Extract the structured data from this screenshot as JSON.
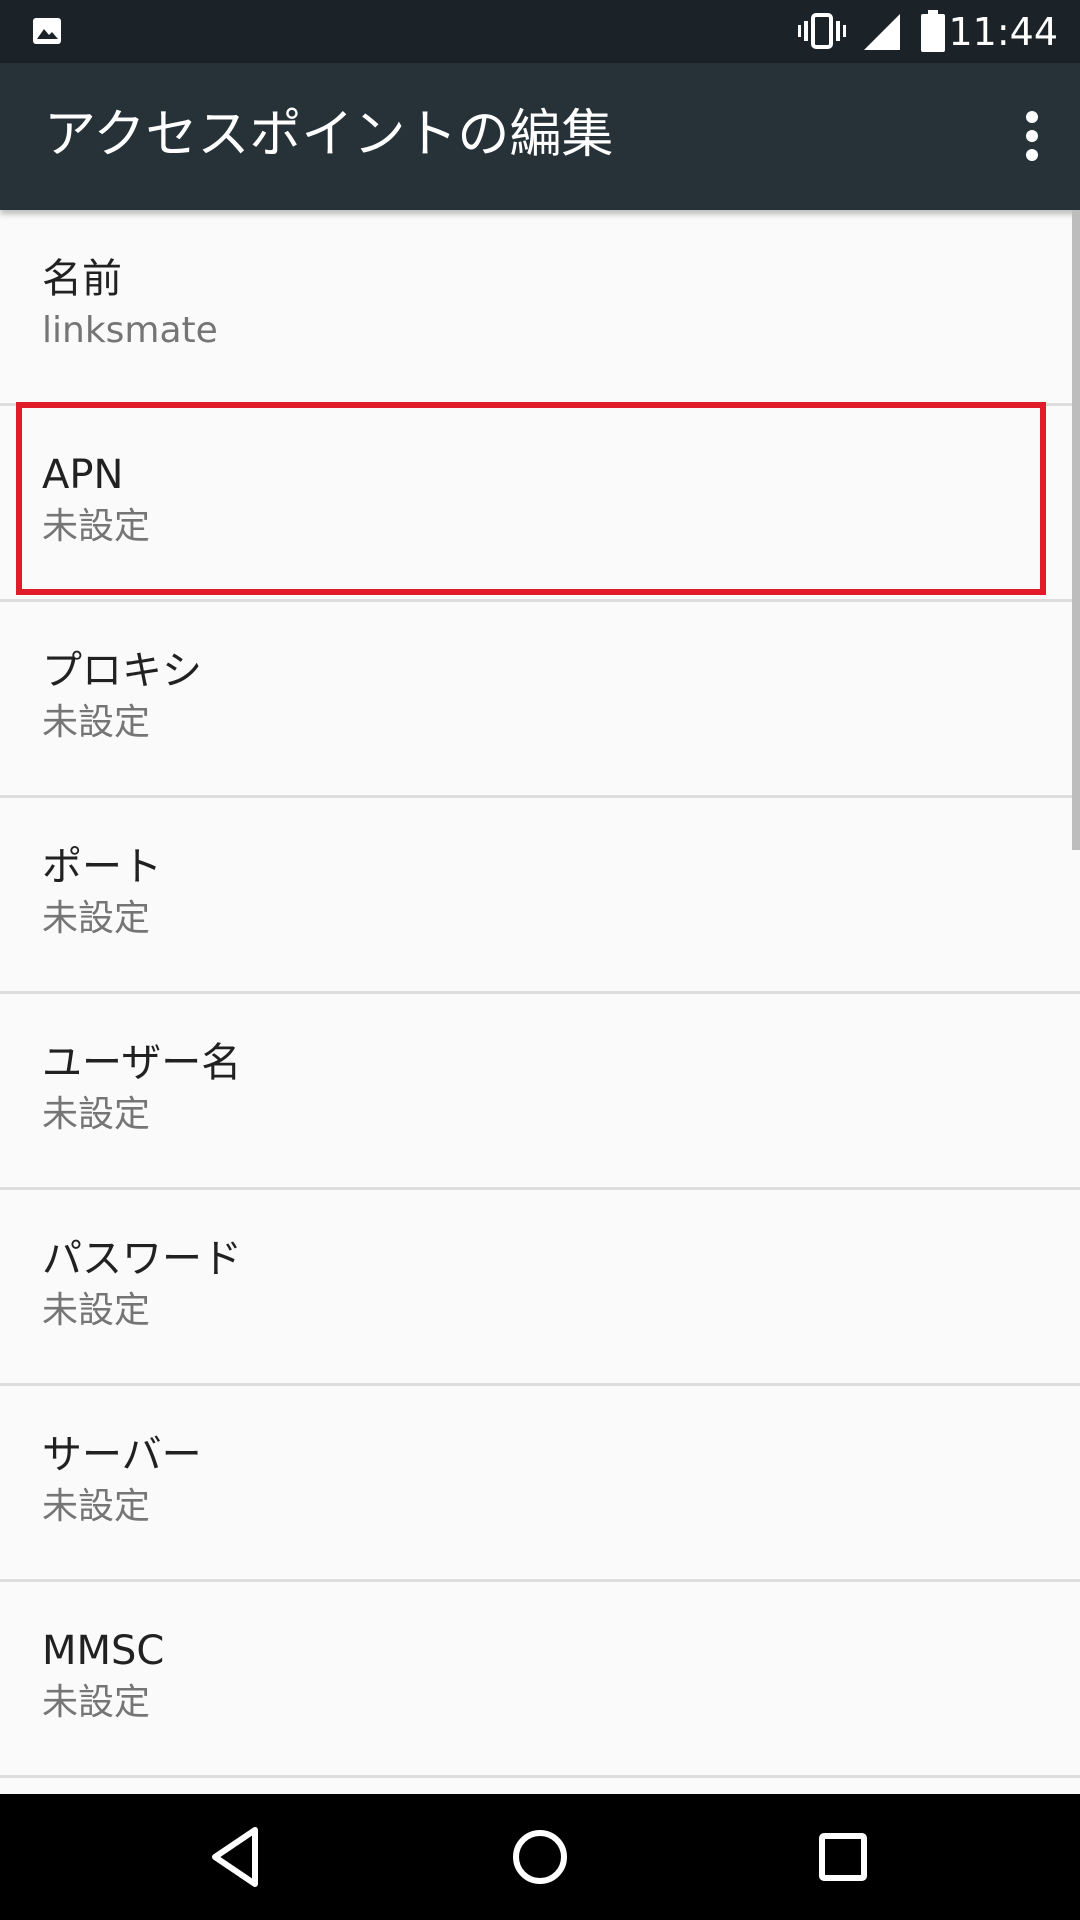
{
  "status_bar": {
    "time": "11:44",
    "icons": [
      "gallery-icon",
      "vibrate-icon",
      "signal-icon",
      "battery-icon"
    ]
  },
  "app_bar": {
    "title": "アクセスポイントの編集",
    "overflow_icon": "more-vert-icon"
  },
  "items": [
    {
      "label": "名前",
      "value": "linksmate"
    },
    {
      "label": "APN",
      "value": "未設定"
    },
    {
      "label": "プロキシ",
      "value": "未設定"
    },
    {
      "label": "ポート",
      "value": "未設定"
    },
    {
      "label": "ユーザー名",
      "value": "未設定"
    },
    {
      "label": "パスワード",
      "value": "未設定"
    },
    {
      "label": "サーバー",
      "value": "未設定"
    },
    {
      "label": "MMSC",
      "value": "未設定"
    }
  ],
  "colors": {
    "status_bar": "#1b2328",
    "app_bar": "#263238",
    "highlight": "#e01c2a",
    "background": "#fafafa"
  },
  "nav_bar": {
    "icons": [
      "back-icon",
      "home-icon",
      "recents-icon"
    ]
  }
}
